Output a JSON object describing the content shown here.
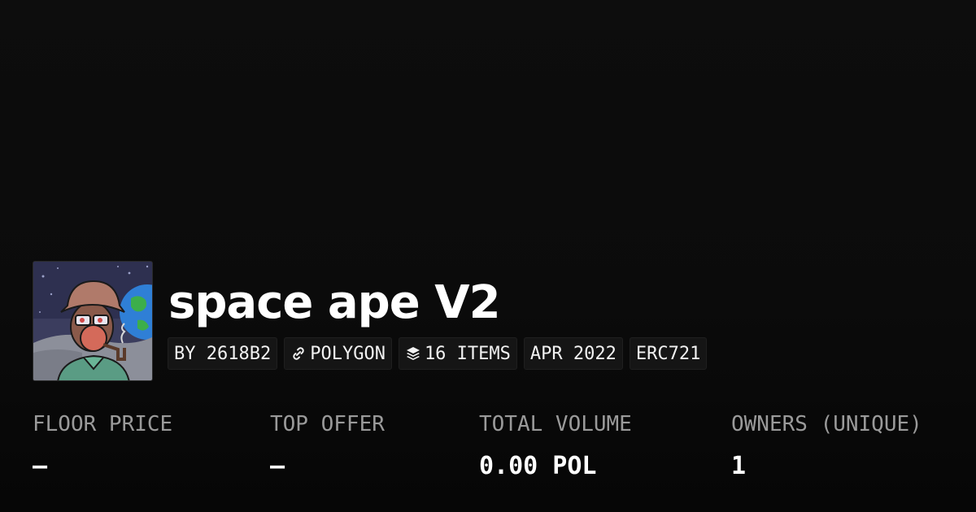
{
  "collection": {
    "title": "space ape V2"
  },
  "tags": {
    "creator": "BY 2618B2",
    "chain": "POLYGON",
    "items": "16 ITEMS",
    "date": "APR 2022",
    "standard": "ERC721"
  },
  "icons": {
    "chain": "link-icon",
    "items": "layers-icon",
    "avatar": "collection-avatar-image"
  },
  "stats": {
    "floor_price": {
      "label": "FLOOR PRICE",
      "value": "—"
    },
    "top_offer": {
      "label": "TOP OFFER",
      "value": "—"
    },
    "total_volume": {
      "label": "TOTAL VOLUME",
      "value": "0.00 POL"
    },
    "owners": {
      "label": "OWNERS (UNIQUE)",
      "value": "1"
    }
  },
  "colors": {
    "background": "#0a0a0a",
    "tag_background": "#151515",
    "label": "#9a9a9a",
    "text": "#ffffff"
  }
}
